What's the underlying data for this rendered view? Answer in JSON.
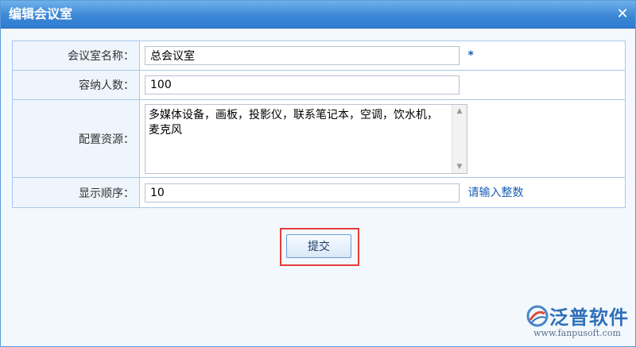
{
  "dialog": {
    "title": "编辑会议室",
    "close_icon": "close-icon"
  },
  "form": {
    "rows": [
      {
        "label": "会议室名称：",
        "value": "总会议室",
        "suffix": "*"
      },
      {
        "label": "容纳人数：",
        "value": "100"
      },
      {
        "label": "配置资源：",
        "value": "多媒体设备，画板，投影仪，联系笔记本，空调，饮水机，麦克风"
      },
      {
        "label": "显示顺序：",
        "value": "10",
        "hint": "请输入整数"
      }
    ]
  },
  "actions": {
    "submit_label": "提交"
  },
  "logo": {
    "name": "泛普软件",
    "url": "www.fanpusoft.com"
  },
  "colors": {
    "title_bar": "#3c88d6",
    "accent": "#1a5fb4",
    "highlight_border": "#e53b3b"
  }
}
